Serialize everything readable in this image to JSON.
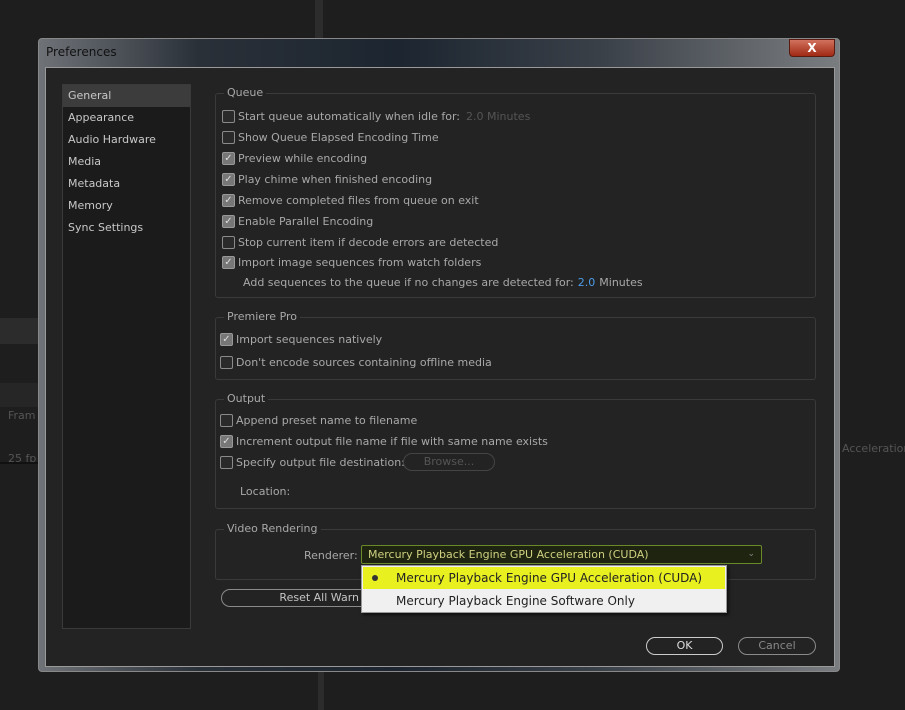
{
  "background": {
    "frame_label": "Fram",
    "fps_label": "25 fp",
    "accel_label": "Acceleration"
  },
  "dialog": {
    "title": "Preferences",
    "close_label": "X"
  },
  "sidebar": {
    "items": [
      {
        "label": "General",
        "selected": true
      },
      {
        "label": "Appearance"
      },
      {
        "label": "Audio Hardware"
      },
      {
        "label": "Media"
      },
      {
        "label": "Metadata"
      },
      {
        "label": "Memory"
      },
      {
        "label": "Sync Settings"
      }
    ]
  },
  "queue": {
    "title": "Queue",
    "items": [
      {
        "label": "Start queue automatically when idle for:",
        "checked": false,
        "suffix": "2.0 Minutes"
      },
      {
        "label": "Show Queue Elapsed Encoding Time",
        "checked": false
      },
      {
        "label": "Preview while encoding",
        "checked": true
      },
      {
        "label": "Play chime when finished encoding",
        "checked": true
      },
      {
        "label": "Remove completed files from queue on exit",
        "checked": true
      },
      {
        "label": "Enable Parallel Encoding",
        "checked": true
      },
      {
        "label": "Stop current item if decode errors are detected",
        "checked": false
      },
      {
        "label": "Import image sequences from watch folders",
        "checked": true
      }
    ],
    "add_seq_label": "Add sequences to the queue if no changes are detected for:",
    "add_seq_value": "2.0",
    "add_seq_unit": "Minutes"
  },
  "premiere": {
    "title": "Premiere Pro",
    "items": [
      {
        "label": "Import sequences natively",
        "checked": true
      },
      {
        "label": "Don't encode sources containing offline media",
        "checked": false
      }
    ]
  },
  "output": {
    "title": "Output",
    "items": [
      {
        "label": "Append preset name to filename",
        "checked": false
      },
      {
        "label": "Increment output file name if file with same name exists",
        "checked": true
      },
      {
        "label": "Specify output file destination:",
        "checked": false
      }
    ],
    "browse_label": "Browse...",
    "location_label": "Location:"
  },
  "video": {
    "title": "Video Rendering",
    "renderer_label": "Renderer:",
    "renderer_value": "Mercury Playback Engine GPU Acceleration (CUDA)",
    "options": [
      "Mercury Playback Engine GPU Acceleration (CUDA)",
      "Mercury Playback Engine Software Only"
    ]
  },
  "reset_label": "Reset All Warn",
  "ok_label": "OK",
  "cancel_label": "Cancel",
  "colors": {
    "highlight": "#e8f020",
    "accent": "#4c9ce8"
  }
}
